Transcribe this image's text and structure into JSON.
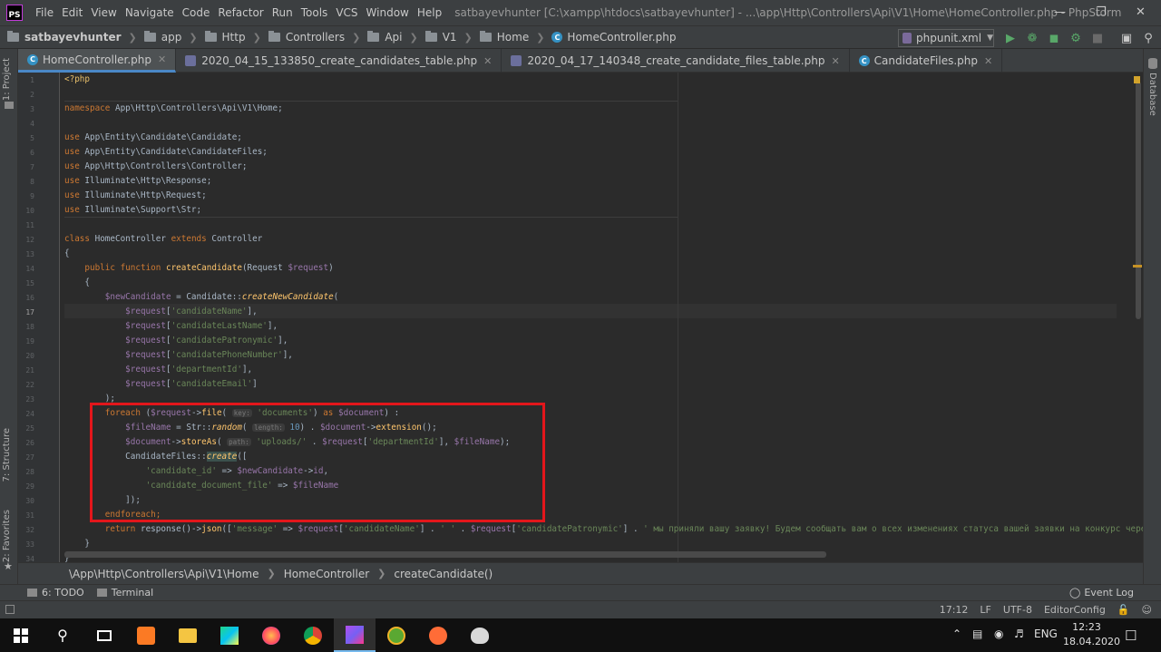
{
  "menu": [
    "File",
    "Edit",
    "View",
    "Navigate",
    "Code",
    "Refactor",
    "Run",
    "Tools",
    "VCS",
    "Window",
    "Help"
  ],
  "window_title": "satbayevhunter [C:\\xampp\\htdocs\\satbayevhunter] - ...\\app\\Http\\Controllers\\Api\\V1\\Home\\HomeController.php - PhpStorm",
  "app_logo_text": "PS",
  "navbar": {
    "crumbs": [
      "satbayevhunter",
      "app",
      "Http",
      "Controllers",
      "Api",
      "V1",
      "Home"
    ],
    "file": "HomeController.php",
    "run_config": "phpunit.xml"
  },
  "tabs": [
    {
      "label": "HomeController.php",
      "icon": "class-icon"
    },
    {
      "label": "2020_04_15_133850_create_candidates_table.php",
      "icon": "migration-icon"
    },
    {
      "label": "2020_04_17_140348_create_candidate_files_table.php",
      "icon": "migration-icon"
    },
    {
      "label": "CandidateFiles.php",
      "icon": "class-icon"
    }
  ],
  "side_tabs": {
    "project": "1: Project",
    "structure": "7: Structure",
    "favorites": "2: Favorites",
    "database": "Database"
  },
  "code": {
    "line_numbers": [
      "1",
      "2",
      "3",
      "4",
      "5",
      "6",
      "7",
      "8",
      "9",
      "10",
      "11",
      "12",
      "13",
      "14",
      "15",
      "16",
      "17",
      "18",
      "19",
      "20",
      "21",
      "22",
      "23",
      "24",
      "25",
      "26",
      "27",
      "28",
      "29",
      "30",
      "31",
      "32",
      "33",
      "34"
    ],
    "current_line": "17",
    "l1": "<?php",
    "l3_kw": "namespace",
    "l3_rest": " App\\Http\\Controllers\\Api\\V1\\Home;",
    "use_kw": "use",
    "l5": " App\\Entity\\Candidate\\Candidate;",
    "l6": " App\\Entity\\Candidate\\CandidateFiles;",
    "l7": " App\\Http\\Controllers\\Controller;",
    "l8": " Illuminate\\Http\\Response;",
    "l9": " Illuminate\\Http\\Request;",
    "l10": " Illuminate\\Support\\Str;",
    "l12_class": "class",
    "l12_name": " HomeController ",
    "l12_extends": "extends",
    "l12_parent": " Controller",
    "open_brace": "{",
    "l14_public": "public",
    "l14_function": "function",
    "l14_name": "createCandidate",
    "l14_args_a": "(Request ",
    "l14_var": "$request",
    "l14_args_b": ")",
    "l16_var": "$newCandidate",
    "l16_mid": " = Candidate::",
    "l16_fn": "createNewCandidate",
    "l16_end": "(",
    "req": "$request",
    "l17_key": "'candidateName'",
    "l18_key": "'candidateLastName'",
    "l19_key": "'candidatePatronymic'",
    "l20_key": "'candidatePhoneNumber'",
    "l21_key": "'departmentId'",
    "l22_key": "'candidateEmail'",
    "l23": ");",
    "l24_kw": "foreach",
    "l24_a": " (",
    "l24_fn": "file",
    "l24_hint": "key:",
    "l24_str": "'documents'",
    "l24_as": "as",
    "l24_doc": "$document",
    "l24_end": ") :",
    "l25_var": "$fileName",
    "l25_mid": " = Str::",
    "l25_fn": "random",
    "l25_hint": "length:",
    "l25_num": "10",
    "l25_b": ") . ",
    "l25_doc": "$document",
    "l25_fn2": "extension",
    "l25_end": "();",
    "l26_doc": "$document",
    "l26_fn": "storeAs",
    "l26_hint": "path:",
    "l26_str": "'uploads/'",
    "l26_key": "'departmentId'",
    "l26_var": "$fileName",
    "l26_end": ");",
    "l27_a": "CandidateFiles::",
    "l27_fn": "create",
    "l27_end": "([",
    "l28_str": "'candidate_id'",
    "l28_var": "$newCandidate",
    "l28_prop": "id",
    "l29_str": "'candidate_document_file'",
    "l29_var": "$fileName",
    "l30": "]);",
    "l31": "endforeach;",
    "l32_kw": "return",
    "l32_a": " response()->",
    "l32_fn": "json",
    "l32_b": "([",
    "l32_s1": "'message'",
    "l32_arrow": " => ",
    "l32_key": "'candidateName'",
    "l32_s2": "' '",
    "l32_key2": "'candidatePatronymic'",
    "l32_s3": "' мы приняли вашу заявку! Будем сообщать вам о всех изменениях статуса вашей заявки на конкурс через",
    "close_brace": "}"
  },
  "breadcrumbs": [
    "\\App\\Http\\Controllers\\Api\\V1\\Home",
    "HomeController",
    "createCandidate()"
  ],
  "tool_windows": {
    "todo": "6: TODO",
    "terminal": "Terminal",
    "event_log": "Event Log"
  },
  "status": {
    "position": "17:12",
    "line_sep": "LF",
    "encoding": "UTF-8",
    "editor_config": "EditorConfig"
  },
  "taskbar": {
    "lang": "ENG",
    "time": "12:23",
    "date": "18.04.2020"
  },
  "colors": {
    "accent": "#4a88c7",
    "highlight_box": "#e3161b",
    "keyword": "#cc7832",
    "string": "#6a8759",
    "variable": "#9876aa",
    "function": "#ffc66d"
  }
}
